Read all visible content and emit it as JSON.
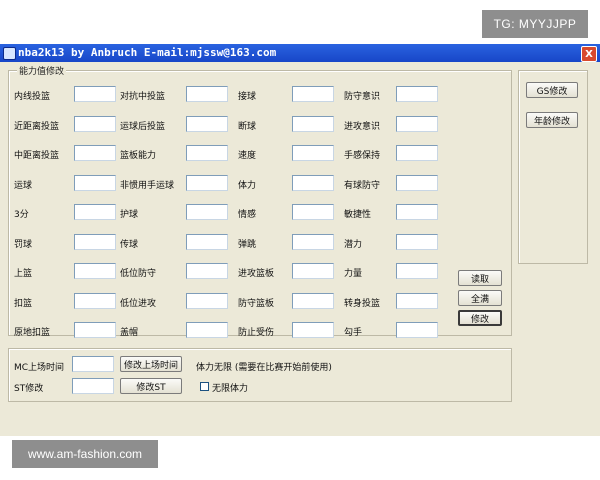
{
  "watermarks": {
    "top": "TG: MYYJJPP",
    "bottom": "www.am-fashion.com"
  },
  "window": {
    "title": "nba2k13  by Anbruch E-mail:mjssw@163.com",
    "close_label": "X"
  },
  "ability_group": {
    "legend": "能力值修改",
    "columns": [
      [
        "内线投篮",
        "近距离投篮",
        "中距离投篮",
        "运球",
        "3分",
        "罚球",
        "上篮",
        "扣篮",
        "原地扣篮"
      ],
      [
        "对抗中投篮",
        "运球后投篮",
        "篮板能力",
        "非惯用手运球",
        "护球",
        "传球",
        "低位防守",
        "低位进攻",
        "盖帽"
      ],
      [
        "接球",
        "断球",
        "速度",
        "体力",
        "情感",
        "弹跳",
        "进攻篮板",
        "防守篮板",
        "防止受伤"
      ],
      [
        "防守意识",
        "进攻意识",
        "手感保持",
        "有球防守",
        "敏捷性",
        "潜力",
        "力量",
        "转身投篮",
        "勾手"
      ]
    ],
    "read_button": "读取",
    "fill_button": "全满",
    "modify_button": "修改"
  },
  "side_buttons": {
    "gs_button": "GS修改",
    "age_button": "年龄修改"
  },
  "bottom_group": {
    "mc_label": "MC上场时间",
    "mc_button": "修改上场时间",
    "stamina_note": "体力无限 (需要在比赛开始前使用)",
    "st_label": "ST修改",
    "st_button": "修改ST",
    "unlimited_stamina_label": "无限体力",
    "unlimited_stamina_checked": false
  }
}
